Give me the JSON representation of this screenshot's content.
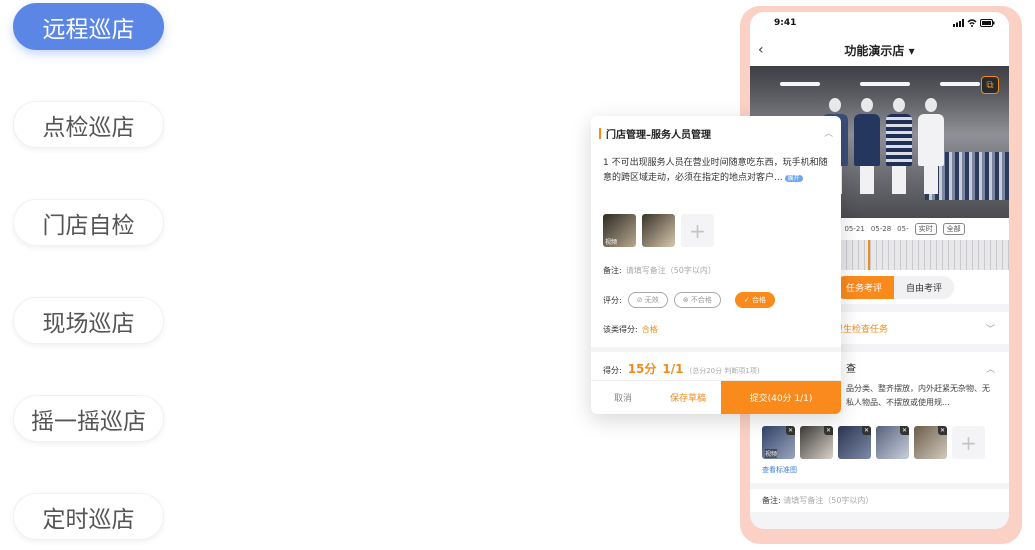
{
  "tabs": [
    {
      "label": "远程巡店",
      "active": true
    },
    {
      "label": "点检巡店",
      "active": false
    },
    {
      "label": "门店自检",
      "active": false
    },
    {
      "label": "现场巡店",
      "active": false
    },
    {
      "label": "摇一摇巡店",
      "active": false
    },
    {
      "label": "定时巡店",
      "active": false
    }
  ],
  "colors": {
    "accent": "#5b86e5",
    "orange": "#fb8a1c",
    "frame": "#fcd1c5"
  },
  "phone": {
    "time": "9:41",
    "nav_title": "功能演示店 ▾",
    "timeline": {
      "dates": [
        "2",
        "05-21",
        "05-28",
        "05-"
      ],
      "realtime_btn": "实时",
      "all_btn": "全部"
    },
    "segment": {
      "active": "任务考评",
      "inactive": "自由考评"
    },
    "task_label": "卫生检查任务",
    "section_title": "查",
    "section_text": "品分类、整齐摆放，内外赶紧无杂物、无私人物品、不摆放或使用规...",
    "thumb_tag": "视频",
    "link": "查看标准图",
    "remark_label": "备注:",
    "remark_placeholder": "请填写备注（50字以内）"
  },
  "overlay": {
    "title": "门店管理–服务人员管理",
    "desc": "1 不可出现服务人员在营业时间随意吃东西，玩手机和随意的跨区域走动，必须在指定的地点对客户...",
    "expand": "展开",
    "photo_tag": "视频",
    "remark_label": "备注:",
    "remark_placeholder": "请填写备注（50字以内）",
    "rate_label": "评分:",
    "rates": [
      {
        "label": "⊘ 无效",
        "on": false
      },
      {
        "label": "⊗ 不合格",
        "on": false
      },
      {
        "label": "✓ 合格",
        "on": true
      }
    ],
    "category_label": "该类得分:",
    "category_value": "合格",
    "score_label": "得分:",
    "score": "15分",
    "ratio": "1/1",
    "score_note": "(总分20分  判断项1项)",
    "cancel": "取消",
    "draft": "保存草稿",
    "submit": "提交(40分 1/1)"
  }
}
